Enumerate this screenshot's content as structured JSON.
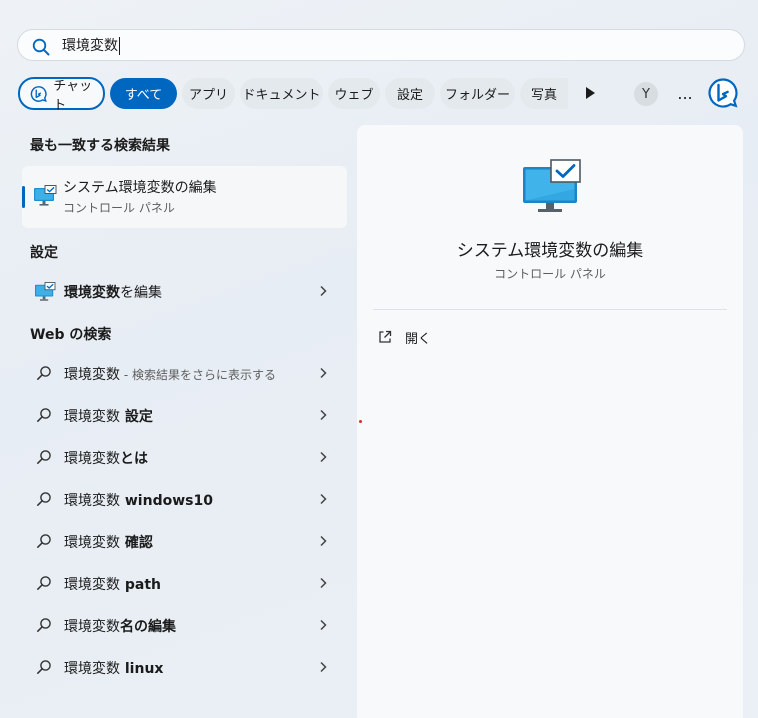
{
  "search": {
    "query": "環境変数"
  },
  "chips": {
    "chat": "チャット",
    "all": "すべて",
    "apps": "アプリ",
    "documents": "ドキュメント",
    "web": "ウェブ",
    "settings": "設定",
    "folders": "フォルダー",
    "photos": "写真",
    "avatar": "Y",
    "more": "..."
  },
  "best_match": {
    "heading": "最も一致する検索結果",
    "title": "システム環境変数の編集",
    "subtitle": "コントロール パネル"
  },
  "settings_section": {
    "heading": "設定",
    "items": [
      {
        "bold": "環境変数",
        "rest": "を編集"
      }
    ]
  },
  "web_section": {
    "heading": "Web の検索",
    "items": [
      {
        "query": "環境変数",
        "suffix": "",
        "hint": " - 検索結果をさらに表示する"
      },
      {
        "query": "環境変数",
        "suffix": " 設定",
        "hint": ""
      },
      {
        "query": "環境変数",
        "suffix": "とは",
        "hint": ""
      },
      {
        "query": "環境変数",
        "suffix": " windows10",
        "hint": ""
      },
      {
        "query": "環境変数",
        "suffix": " 確認",
        "hint": ""
      },
      {
        "query": "環境変数",
        "suffix": " path",
        "hint": ""
      },
      {
        "query": "環境変数",
        "suffix": "名の編集",
        "hint": ""
      },
      {
        "query": "環境変数",
        "suffix": " linux",
        "hint": ""
      }
    ]
  },
  "preview": {
    "title": "システム環境変数の編集",
    "subtitle": "コントロール パネル",
    "open_label": "開く"
  },
  "colors": {
    "accent": "#0067c0",
    "chip_bg": "#e4e9ee",
    "pane_bg": "#f7f9fb"
  }
}
